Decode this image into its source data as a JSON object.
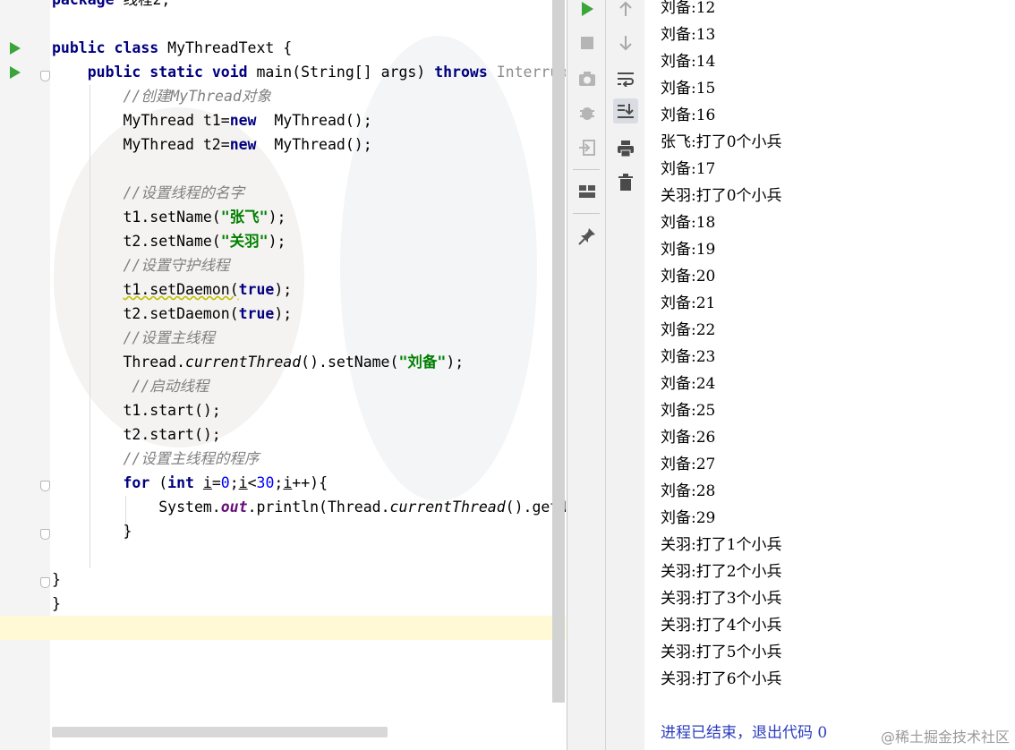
{
  "editor": {
    "lines": [
      [
        {
          "t": "package",
          "c": "kw"
        },
        {
          "t": " 线程2;",
          "c": ""
        }
      ],
      [],
      [
        {
          "t": "public class",
          "c": "kw"
        },
        {
          "t": " MyThreadText {",
          "c": ""
        }
      ],
      [
        {
          "t": "    "
        },
        {
          "t": "public static void",
          "c": "kw"
        },
        {
          "t": " main(String[] args) "
        },
        {
          "t": "throws",
          "c": "kw"
        },
        {
          "t": " Interrupt",
          "c": "dim"
        }
      ],
      [
        {
          "t": "        "
        },
        {
          "t": "//创建MyThread对象",
          "c": "cmt"
        }
      ],
      [
        {
          "t": "        MyThread t1="
        },
        {
          "t": "new",
          "c": "kw"
        },
        {
          "t": "  MyThread();"
        }
      ],
      [
        {
          "t": "        MyThread t2="
        },
        {
          "t": "new",
          "c": "kw"
        },
        {
          "t": "  MyThread();"
        }
      ],
      [],
      [
        {
          "t": "        "
        },
        {
          "t": "//设置线程的名字",
          "c": "cmt"
        }
      ],
      [
        {
          "t": "        t1.setName("
        },
        {
          "t": "\"张飞\"",
          "c": "str"
        },
        {
          "t": ");"
        }
      ],
      [
        {
          "t": "        t2.setName("
        },
        {
          "t": "\"关羽\"",
          "c": "str"
        },
        {
          "t": ");"
        }
      ],
      [
        {
          "t": "        "
        },
        {
          "t": "//设置守护线程",
          "c": "cmt"
        }
      ],
      [
        {
          "t": "        "
        },
        {
          "t": "t1.setDaemon(",
          "c": "wavy"
        },
        {
          "t": "true",
          "c": "kw"
        },
        {
          "t": ");"
        }
      ],
      [
        {
          "t": "        t2.setDaemon("
        },
        {
          "t": "true",
          "c": "kw"
        },
        {
          "t": ");"
        }
      ],
      [
        {
          "t": "        "
        },
        {
          "t": "//设置主线程",
          "c": "cmt"
        }
      ],
      [
        {
          "t": "        Thread."
        },
        {
          "t": "currentThread",
          "c": "itl"
        },
        {
          "t": "().setName("
        },
        {
          "t": "\"刘备\"",
          "c": "str"
        },
        {
          "t": ");"
        }
      ],
      [
        {
          "t": "         "
        },
        {
          "t": "//启动线程",
          "c": "cmt"
        }
      ],
      [
        {
          "t": "        t1.start();"
        }
      ],
      [
        {
          "t": "        t2.start();"
        }
      ],
      [
        {
          "t": "        "
        },
        {
          "t": "//设置主线程的程序",
          "c": "cmt"
        }
      ],
      [
        {
          "t": "        "
        },
        {
          "t": "for",
          "c": "kw"
        },
        {
          "t": " ("
        },
        {
          "t": "int",
          "c": "kw"
        },
        {
          "t": " "
        },
        {
          "t": "i",
          "c": "ul"
        },
        {
          "t": "="
        },
        {
          "t": "0",
          "c": "num"
        },
        {
          "t": ";"
        },
        {
          "t": "i",
          "c": "ul"
        },
        {
          "t": "<"
        },
        {
          "t": "30",
          "c": "num"
        },
        {
          "t": ";"
        },
        {
          "t": "i",
          "c": "ul"
        },
        {
          "t": "++){"
        }
      ],
      [
        {
          "t": "            System."
        },
        {
          "t": "out",
          "c": "fld"
        },
        {
          "t": ".println(Thread."
        },
        {
          "t": "currentThread",
          "c": "itl"
        },
        {
          "t": "().getN"
        }
      ],
      [
        {
          "t": "        }"
        }
      ],
      [],
      [
        {
          "t": "}"
        }
      ],
      [
        {
          "t": "}"
        }
      ]
    ]
  },
  "console": {
    "lines": [
      "刘备:12",
      "刘备:13",
      "刘备:14",
      "刘备:15",
      "刘备:16",
      "张飞:打了0个小兵",
      "刘备:17",
      "关羽:打了0个小兵",
      "刘备:18",
      "刘备:19",
      "刘备:20",
      "刘备:21",
      "刘备:22",
      "刘备:23",
      "刘备:24",
      "刘备:25",
      "刘备:26",
      "刘备:27",
      "刘备:28",
      "刘备:29",
      "关羽:打了1个小兵",
      "关羽:打了2个小兵",
      "关羽:打了3个小兵",
      "关羽:打了4个小兵",
      "关羽:打了5个小兵",
      "关羽:打了6个小兵"
    ],
    "exit_message": "进程已结束，退出代码 0"
  },
  "watermark": "@稀土掘金技术社区",
  "toolbar_left": [
    {
      "icon": "run-icon",
      "color": "#3aa53a"
    },
    {
      "icon": "stop-icon",
      "color": "#b0b0b0"
    },
    {
      "icon": "camera-icon",
      "color": "#b0b0b0"
    },
    {
      "icon": "debug-bug-icon",
      "color": "#b0b0b0"
    },
    {
      "icon": "exit-login-icon",
      "color": "#b0b0b0"
    },
    {
      "icon": "layout-icon",
      "color": "#555555"
    },
    {
      "icon": "pin-icon",
      "color": "#555555"
    }
  ],
  "toolbar_right": [
    {
      "icon": "arrow-up-icon"
    },
    {
      "icon": "arrow-down-icon"
    },
    {
      "icon": "soft-wrap-icon"
    },
    {
      "icon": "scroll-to-end-icon",
      "active": true
    },
    {
      "icon": "print-icon"
    },
    {
      "icon": "trash-icon"
    }
  ]
}
